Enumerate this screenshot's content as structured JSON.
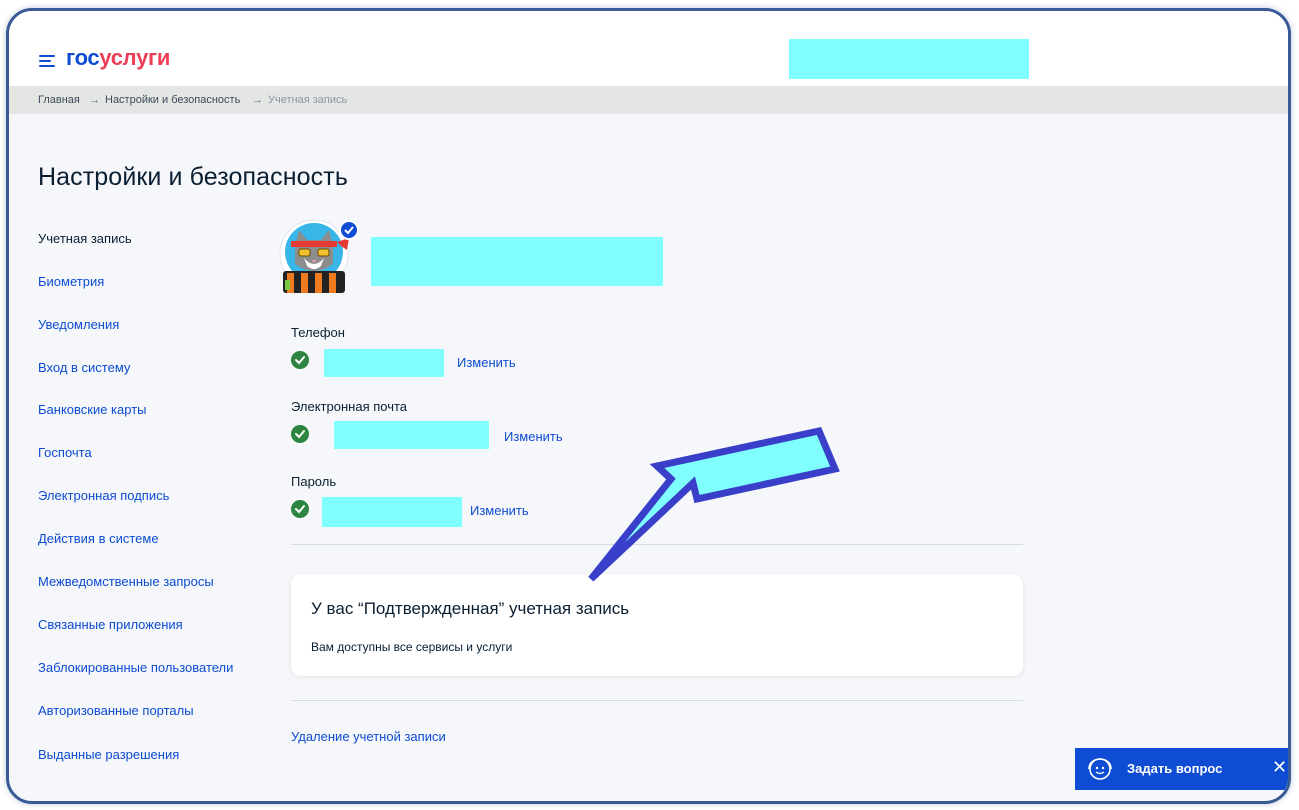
{
  "header": {
    "logo_part1": "гос",
    "logo_part2": "услуги",
    "logo_color_primary": "#0d4cd3",
    "logo_color_accent": "#ee3f58"
  },
  "breadcrumb": {
    "items": [
      "Главная",
      "Настройки и безопасность"
    ],
    "separator": "→",
    "current": "Учетная запись"
  },
  "page": {
    "title": "Настройки и безопасность"
  },
  "sidebar": {
    "items": [
      {
        "label": "Учетная запись",
        "active": true
      },
      {
        "label": "Биометрия"
      },
      {
        "label": "Уведомления"
      },
      {
        "label": "Вход в систему"
      },
      {
        "label": "Банковские карты"
      },
      {
        "label": "Госпочта"
      },
      {
        "label": "Электронная подпись"
      },
      {
        "label": "Действия в системе"
      },
      {
        "label": "Межведомственные запросы"
      },
      {
        "label": "Связанные приложения"
      },
      {
        "label": "Заблокированные пользователи"
      },
      {
        "label": "Авторизованные порталы"
      },
      {
        "label": "Выданные разрешения"
      }
    ]
  },
  "account": {
    "phone_label": "Телефон",
    "email_label": "Электронная почта",
    "password_label": "Пароль",
    "change_label": "Изменить",
    "verified_color": "#2e8540"
  },
  "status_card": {
    "title": "У вас “Подтвержденная” учетная запись",
    "subtitle": "Вам доступны все сервисы и услуги"
  },
  "delete_link": "Удаление учетной записи",
  "chat": {
    "label": "Задать вопрос",
    "close": "✕",
    "color": "#0d4cd3"
  },
  "annotation": {
    "arrow_fill": "#80ffff",
    "arrow_stroke": "#3a3fc9"
  }
}
